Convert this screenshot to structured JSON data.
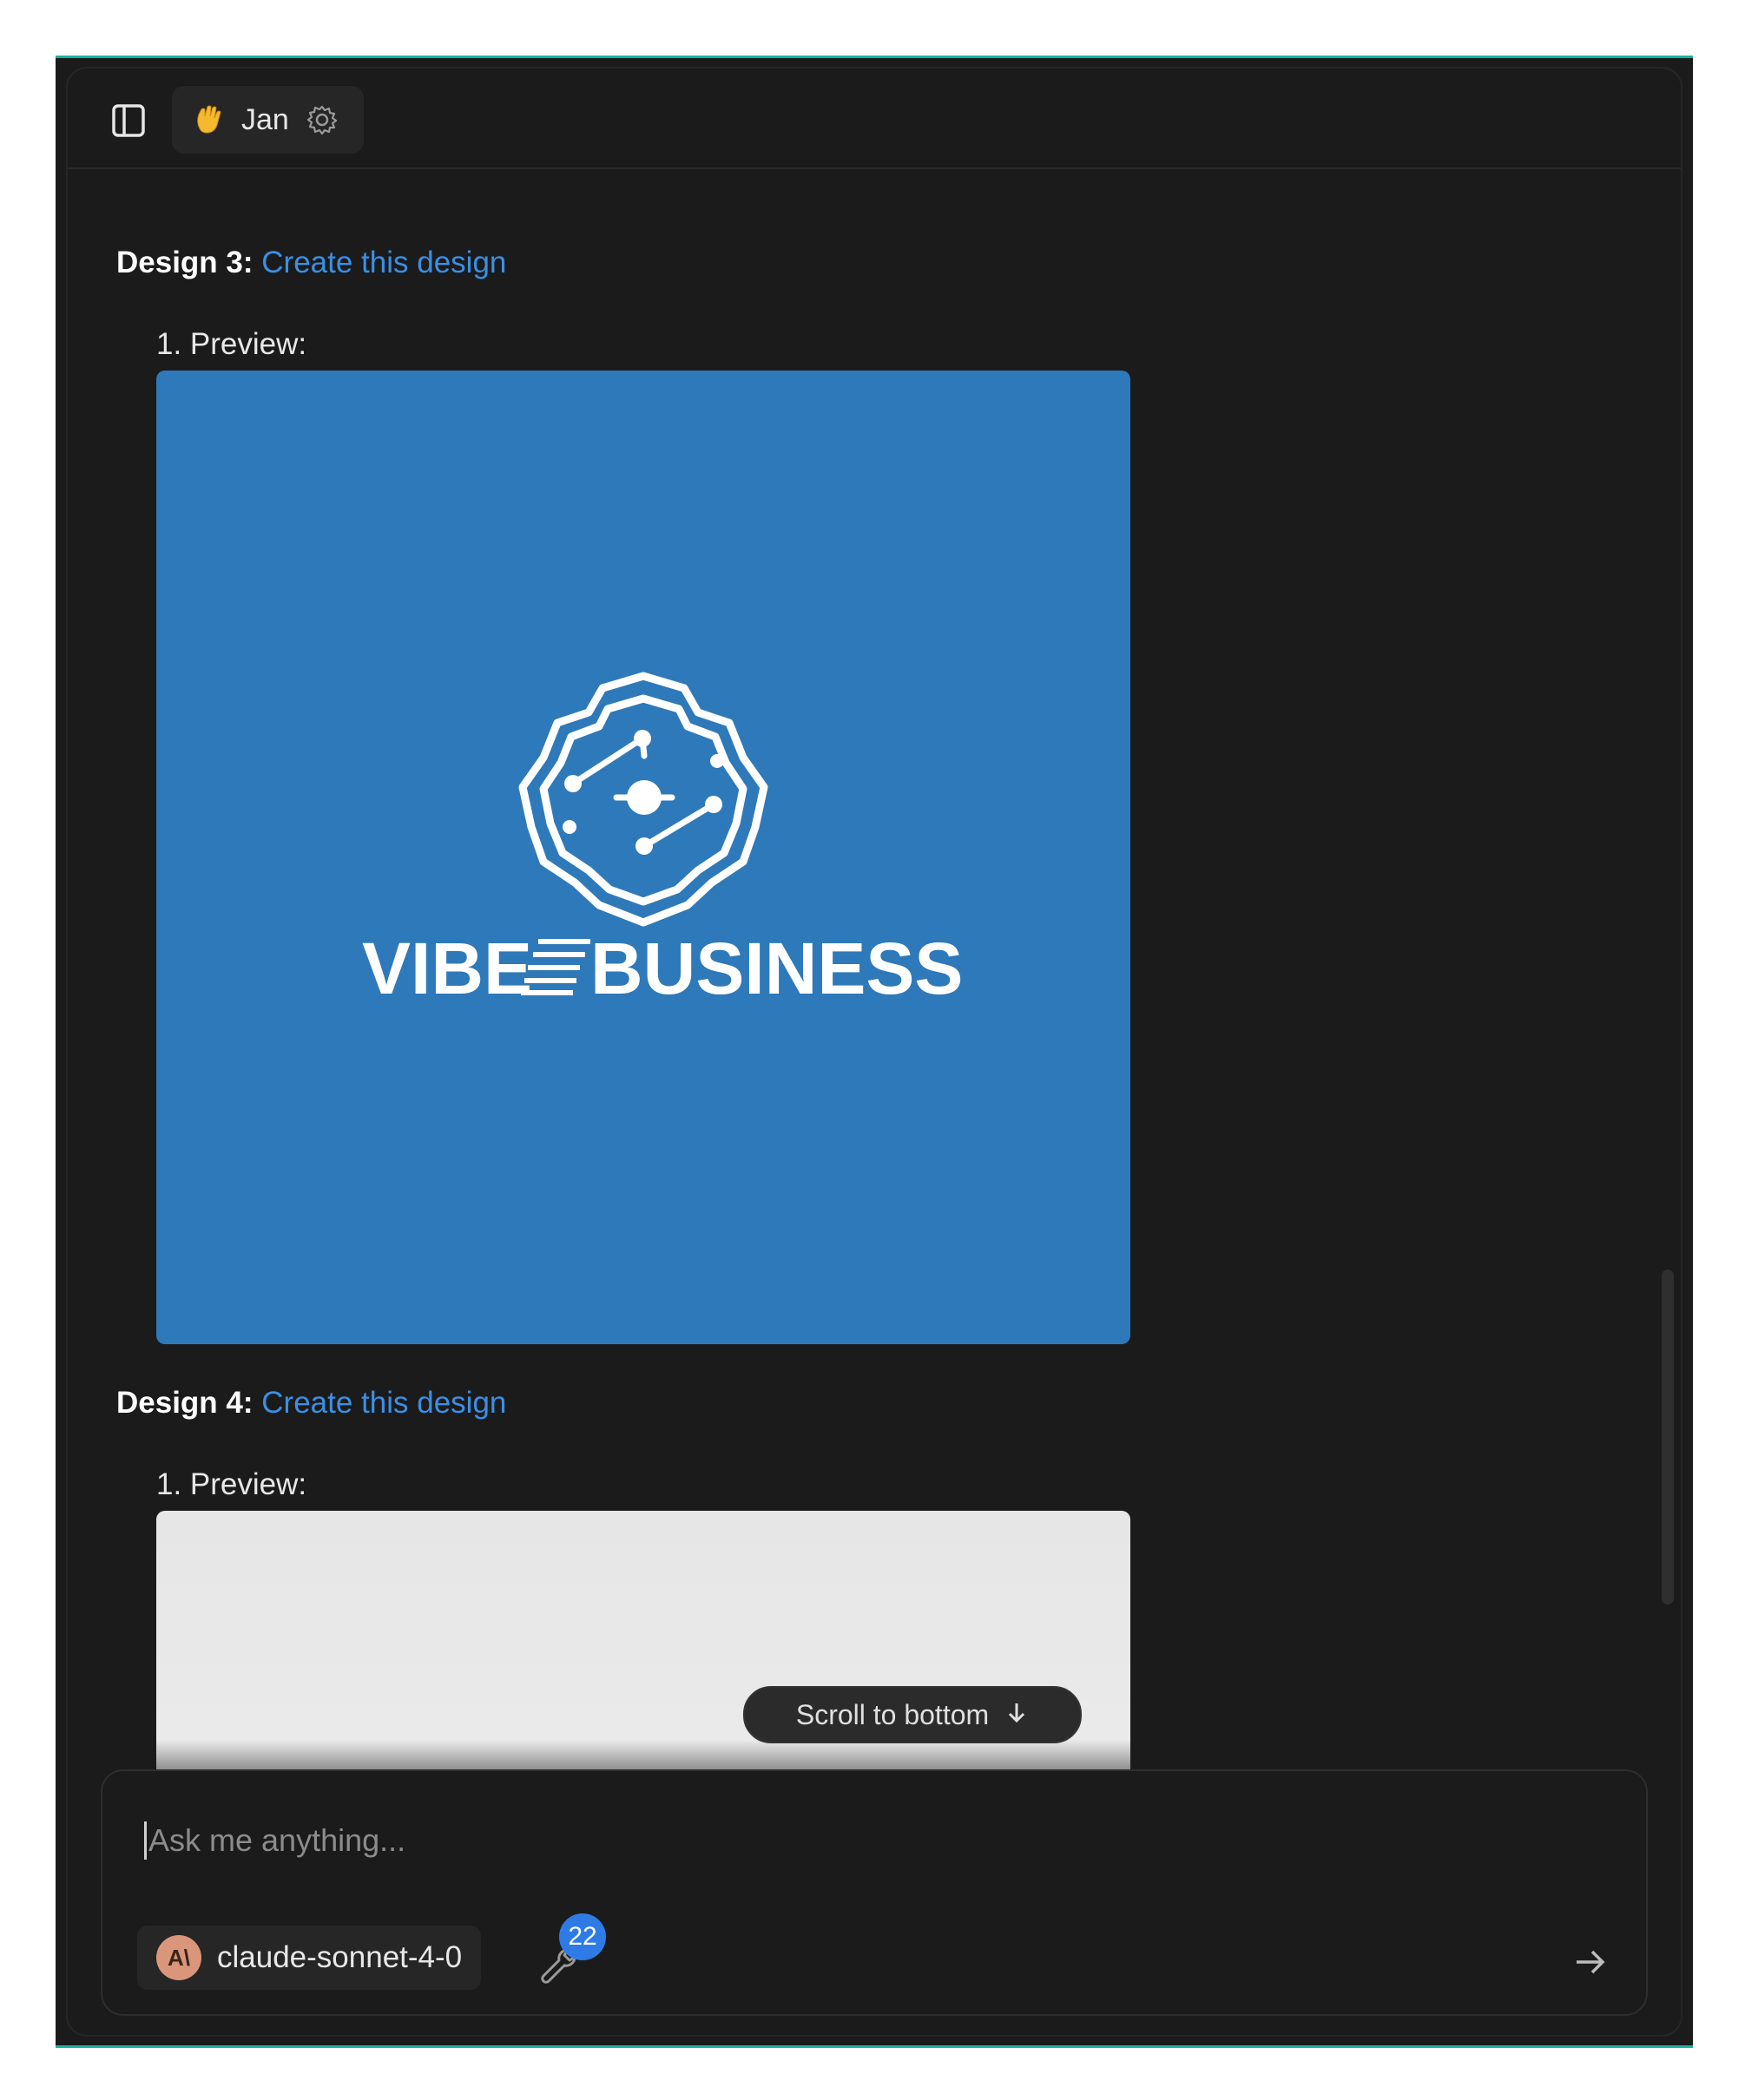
{
  "header": {
    "assistant_name": "Jan",
    "assistant_emoji": "👋"
  },
  "chat": {
    "designs": [
      {
        "heading_label": "Design 3:",
        "link_label": "Create this design",
        "preview_label": "1. Preview:",
        "preview_brand_text": "VIBE",
        "preview_brand_text_2": "BUSINESS",
        "preview_background": "#2e79b9"
      },
      {
        "heading_label": "Design 4:",
        "link_label": "Create this design",
        "preview_label": "1. Preview:",
        "preview_background": "#e6e6e6"
      }
    ],
    "scroll_to_bottom_label": "Scroll to bottom"
  },
  "composer": {
    "placeholder": "Ask me anything...",
    "model_name": "claude-sonnet-4-0",
    "model_avatar_text": "A\\",
    "tools_count": "22"
  },
  "colors": {
    "accent_link": "#3b8fe5",
    "badge_blue": "#2f7be6",
    "frame_teal": "#16b3a2"
  }
}
